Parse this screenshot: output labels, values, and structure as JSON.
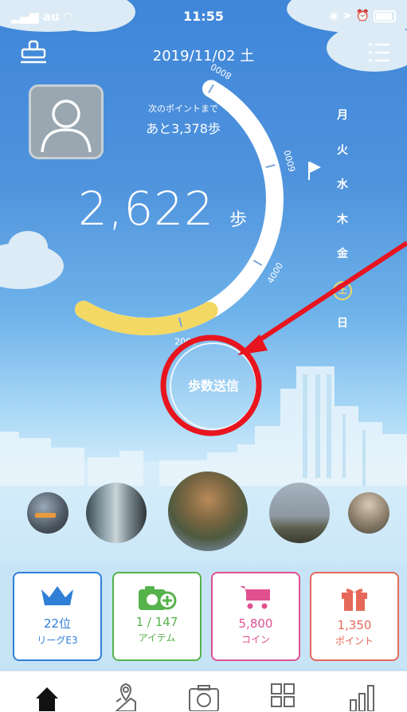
{
  "status_bar": {
    "carrier": "au",
    "time": "11:55"
  },
  "header": {
    "date": "2019/11/02 土"
  },
  "progress": {
    "to_next_label": "次のポイントまで",
    "remaining": "あと3,378歩"
  },
  "steps": {
    "count": "2,622",
    "unit": "歩"
  },
  "gauge": {
    "ticks": [
      "2000",
      "4000",
      "6000",
      "8000"
    ],
    "current_steps": 2622,
    "goal_steps": 8000
  },
  "weekdays": [
    "月",
    "火",
    "水",
    "木",
    "金",
    "土",
    "日"
  ],
  "send_button": {
    "label": "歩数送信"
  },
  "cards": [
    {
      "value": "22位",
      "label": "リーグE3",
      "icon": "crown-icon",
      "color": "#2f7fd6"
    },
    {
      "value": "1 / 147",
      "label": "アイテム",
      "icon": "camera-plus-icon",
      "color": "#56b24a"
    },
    {
      "value": "5,800",
      "label": "コイン",
      "icon": "cart-icon",
      "color": "#e0508f"
    },
    {
      "value": "1,350",
      "label": "ポイント",
      "icon": "gift-icon",
      "color": "#e6685a"
    }
  ],
  "tabs": [
    "home-icon",
    "map-pin-icon",
    "camera-icon",
    "grid-icon",
    "bar-chart-icon"
  ],
  "colors": {
    "sky": "#4f93dd",
    "gauge_fill": "#f3d864",
    "annotation": "#e8141e"
  }
}
